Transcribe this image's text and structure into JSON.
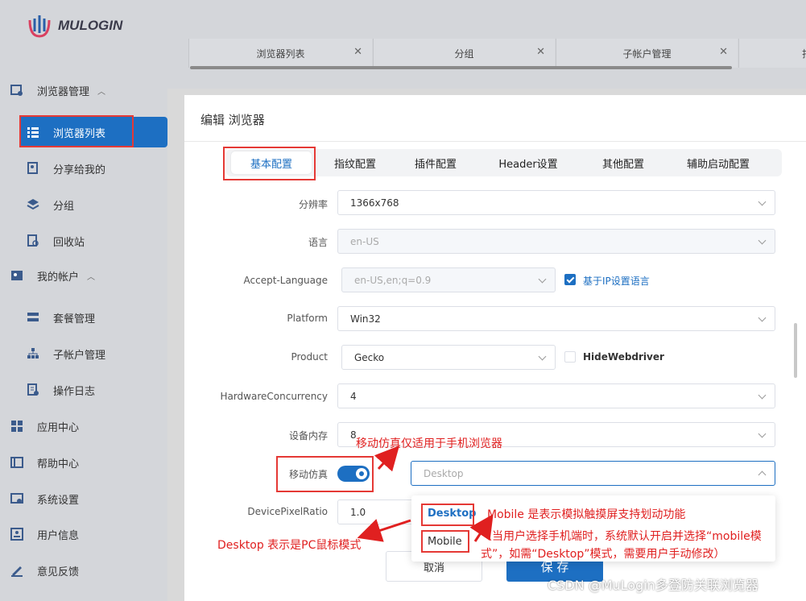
{
  "app": {
    "logo_text": "MULOGIN"
  },
  "sidebar": {
    "items": [
      {
        "label": "浏览器管理",
        "icon": "browser-manage-icon",
        "level": 1,
        "expanded": true
      },
      {
        "label": "浏览器列表",
        "icon": "list-icon",
        "level": 2,
        "active": true
      },
      {
        "label": "分享给我的",
        "icon": "share-icon",
        "level": 2
      },
      {
        "label": "分组",
        "icon": "layers-icon",
        "level": 2
      },
      {
        "label": "回收站",
        "icon": "recycle-icon",
        "level": 2
      },
      {
        "label": "我的帐户",
        "icon": "user-icon",
        "level": 1,
        "expanded": true
      },
      {
        "label": "套餐管理",
        "icon": "package-icon",
        "level": 2
      },
      {
        "label": "子帐户管理",
        "icon": "sub-account-icon",
        "level": 2
      },
      {
        "label": "操作日志",
        "icon": "log-icon",
        "level": 2
      },
      {
        "label": "应用中心",
        "icon": "apps-icon",
        "level": 1
      },
      {
        "label": "帮助中心",
        "icon": "help-icon",
        "level": 1
      },
      {
        "label": "系统设置",
        "icon": "settings-icon",
        "level": 1
      },
      {
        "label": "用户信息",
        "icon": "userinfo-icon",
        "level": 1
      },
      {
        "label": "意见反馈",
        "icon": "feedback-icon",
        "level": 1
      }
    ]
  },
  "tabs": [
    {
      "label": "浏览器列表"
    },
    {
      "label": "分组"
    },
    {
      "label": "子帐户管理"
    },
    {
      "label": "扫"
    }
  ],
  "modal": {
    "title": "编辑 浏览器",
    "subtabs": [
      "基本配置",
      "指纹配置",
      "插件配置",
      "Header设置",
      "其他配置",
      "辅助启动配置"
    ],
    "active_subtab": "基本配置",
    "fields": {
      "resolution": {
        "label": "分辨率",
        "value": "1366x768"
      },
      "language": {
        "label": "语言",
        "value": "en-US"
      },
      "accept_language": {
        "label": "Accept-Language",
        "value": "en-US,en;q=0.9",
        "checkbox_label": "基于IP设置语言",
        "checked": true
      },
      "platform": {
        "label": "Platform",
        "value": "Win32"
      },
      "product": {
        "label": "Product",
        "value": "Gecko",
        "checkbox_label": "HideWebdriver",
        "checked": false
      },
      "hardware_concurrency": {
        "label": "HardwareConcurrency",
        "value": "4"
      },
      "device_memory": {
        "label": "设备内存",
        "value": "8"
      },
      "mobile_emulation": {
        "label": "移动仿真",
        "enabled": true,
        "placeholder": "Desktop"
      },
      "device_pixel_ratio": {
        "label": "DevicePixelRatio",
        "value": "1.0"
      }
    },
    "dropdown_options": [
      "Desktop",
      "Mobile"
    ],
    "cancel_label": "取消",
    "save_label": "保 存"
  },
  "annotations": {
    "mobile_note": "移动仿真仅适用于手机浏览器",
    "mobile_desc": "Mobile 是表示模拟触摸屏支持划动功能",
    "mobile_detail_1": "（当用户选择手机端时，系统默认开启并选择“mobile模",
    "mobile_detail_2": "式”，如需“Desktop”模式，需要用户手动修改）",
    "desktop_desc": "Desktop 表示是PC鼠标模式"
  },
  "watermark": "CSDN @MuLogin多登防关联浏览器",
  "colors": {
    "primary": "#1d6fc2",
    "annotation": "#e53935",
    "sidebar_bg": "#d4d6da"
  }
}
